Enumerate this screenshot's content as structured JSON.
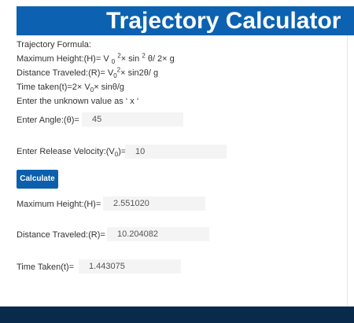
{
  "header": {
    "title": "Trajectory Calculator"
  },
  "formulas": {
    "heading": "Trajectory Formula:",
    "max_height": {
      "label": "Maximum Height:(H)= V",
      "sub0": "0",
      "sup2": "2",
      "mid": "× sin",
      "sup2b": "2",
      "tail": " θ/ 2× g"
    },
    "distance": {
      "label": "Distance Traveled:(R)= V",
      "sub0": "0",
      "sup2": "2",
      "tail": "× sin2θ/ g"
    },
    "time": {
      "label": "Time taken(t)=2× V",
      "sub0": "0",
      "tail": "× sinθ/g"
    },
    "instruction": "Enter the unknown value as ‘ x ‘"
  },
  "inputs": {
    "angle": {
      "label": "Enter Angle:(θ)=",
      "value": "45"
    },
    "velocity": {
      "label_pre": "Enter Release Velocity:(V",
      "label_sub": "0",
      "label_post": ")=",
      "value": "10"
    }
  },
  "actions": {
    "calculate_label": "Calculate"
  },
  "results": {
    "max_height": {
      "label": "Maximum Height:(H)=",
      "value": "2.551020"
    },
    "distance": {
      "label": "Distance Traveled:(R)=",
      "value": "10.204082"
    },
    "time": {
      "label": "Time Taken(t)=",
      "value": "1.443075"
    }
  },
  "colors": {
    "header_bg": "#0c62b0",
    "button_bg": "#0c5fad",
    "footer_bg": "#0a2a4b",
    "field_bg": "#f4f4f4"
  }
}
